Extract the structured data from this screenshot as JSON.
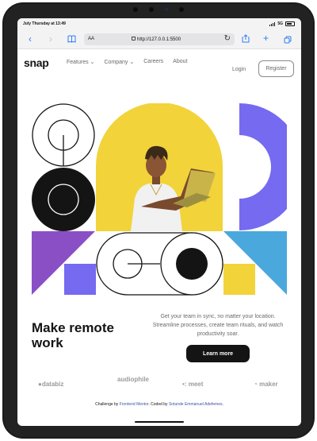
{
  "status_bar": {
    "time": "July Thursday at 13:49",
    "network": "5G"
  },
  "browser": {
    "text_size_label": "AA",
    "url": "http://127.0.0.1:5500",
    "accent": "#2f7cf6"
  },
  "site": {
    "logo": "snap",
    "nav": [
      {
        "label": "Features",
        "has_dropdown": true
      },
      {
        "label": "Company",
        "has_dropdown": true
      },
      {
        "label": "Careers",
        "has_dropdown": false
      },
      {
        "label": "About",
        "has_dropdown": false
      }
    ],
    "login_label": "Login",
    "register_label": "Register",
    "headline": "Make remote work",
    "subtext": "Get your team in sync, no matter your location. Streamline processes, create team rituals, and watch productivity soar.",
    "cta_label": "Learn more",
    "clients": [
      "databiz",
      "audiophile",
      "meet",
      "maker"
    ],
    "attribution": {
      "prefix": "Challenge by ",
      "mentor": "Frontend Mentor",
      "middle": ". Coded by ",
      "author": "Sotunde Emmanuel Adefemes",
      "suffix": "."
    },
    "colors": {
      "dark": "#141414",
      "gray": "#696969",
      "yellow": "#f2d33a",
      "purple": "#8a4fc5",
      "violet": "#756af0",
      "cyan": "#4aa8dd"
    }
  }
}
